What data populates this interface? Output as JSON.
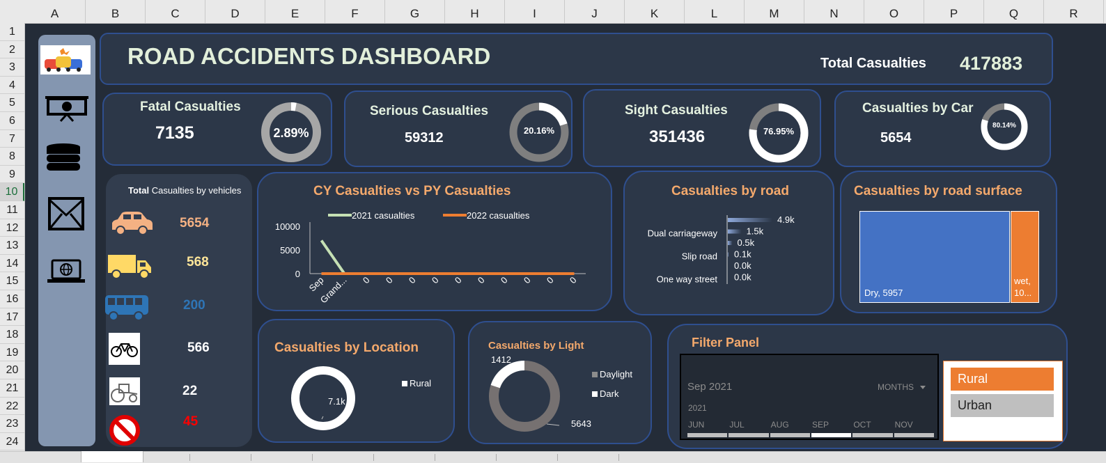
{
  "spreadsheet": {
    "columns": [
      "A",
      "B",
      "C",
      "D",
      "E",
      "F",
      "G",
      "H",
      "I",
      "J",
      "K",
      "L",
      "M",
      "N",
      "O",
      "P",
      "Q",
      "R"
    ],
    "rows": [
      "1",
      "2",
      "3",
      "4",
      "5",
      "6",
      "7",
      "8",
      "9",
      "10",
      "11",
      "12",
      "13",
      "14",
      "15",
      "16",
      "17",
      "18",
      "19",
      "20",
      "21",
      "22",
      "23",
      "24"
    ],
    "selected_row": "10"
  },
  "sidebar": {
    "icons": [
      "car-crash-icon",
      "presentation-chart-icon",
      "database-icon",
      "mail-icon",
      "laptop-globe-icon"
    ]
  },
  "header": {
    "title": "ROAD ACCIDENTS DASHBOARD",
    "total_label": "Total Casualties",
    "total_value": "417883"
  },
  "kpis": [
    {
      "label": "Fatal Casualties",
      "value": "7135",
      "pct_label": "2.89%",
      "fraction": 0.0289
    },
    {
      "label": "Serious Casualties",
      "value": "59312",
      "pct_label": "20.16%",
      "fraction": 0.2016
    },
    {
      "label": "Sight Casualties",
      "value": "351436",
      "pct_label": "76.95%",
      "fraction": 0.7695
    },
    {
      "label": "Casualties by Car",
      "value": "5654",
      "pct_label": "80.14%",
      "fraction": 0.8014
    }
  ],
  "vehicles": {
    "title_bold": "Total",
    "title_rest": " Casualties by vehicles",
    "items": [
      {
        "icon": "car-icon",
        "value": "5654",
        "color": "#f4b183"
      },
      {
        "icon": "truck-icon",
        "value": "568",
        "color": "#ffe699"
      },
      {
        "icon": "bus-icon",
        "value": "200",
        "color": "#2e75b6"
      },
      {
        "icon": "bicycle-icon",
        "value": "566",
        "color": "#ffffff"
      },
      {
        "icon": "tractor-icon",
        "value": "22",
        "color": "#ffffff"
      },
      {
        "icon": "no-entry-icon",
        "value": "45",
        "color": "#ff0000"
      }
    ]
  },
  "colors": {
    "panel": "#2c3748",
    "border": "#2f4f8f",
    "accent": "#f4a96c",
    "series_2021": "#c5e0b4",
    "series_2022": "#ed7d31",
    "dry": "#4472c4",
    "wet": "#ed7d31"
  },
  "chart_data": [
    {
      "type": "line",
      "title": "CY Casualties vs PY Casualties",
      "categories": [
        "Sep",
        "Grand...",
        "0",
        "0",
        "0",
        "0",
        "0",
        "0",
        "0",
        "0",
        "0",
        "0"
      ],
      "series": [
        {
          "name": "2021 casualties",
          "values": [
            7000,
            0,
            null,
            null,
            null,
            null,
            null,
            null,
            null,
            null,
            null,
            null
          ]
        },
        {
          "name": "2022 casualties",
          "values": [
            0,
            0,
            0,
            0,
            0,
            0,
            0,
            0,
            0,
            0,
            0,
            0
          ]
        }
      ],
      "yticks": [
        "10000",
        "5000",
        "0"
      ],
      "ylim": [
        0,
        10000
      ],
      "legend": "top"
    },
    {
      "type": "bar",
      "title": "Casualties by road",
      "categories": [
        "",
        "Dual carriageway",
        "",
        "Slip road",
        "",
        "One way street"
      ],
      "values": [
        4.9,
        1.5,
        0.5,
        0.1,
        0.0,
        0.0
      ],
      "value_labels": [
        "4.9k",
        "1.5k",
        "0.5k",
        "0.1k",
        "0.0k",
        "0.0k"
      ],
      "xlim": [
        0,
        4.9
      ]
    },
    {
      "type": "treemap",
      "title": "Casualties by road surface",
      "items": [
        {
          "label": "Dry, 5957",
          "value": 5957
        },
        {
          "label": "wet, 10...",
          "value": 1000
        }
      ]
    },
    {
      "type": "pie",
      "title": "Casualties by Location",
      "slices": [
        {
          "name": "Rural",
          "value": 7100
        }
      ],
      "data_labels": [
        "7.1k"
      ],
      "legend": "right"
    },
    {
      "type": "pie",
      "title": "Casualties by Light",
      "slices": [
        {
          "name": "Daylight",
          "value": 5643
        },
        {
          "name": "Dark",
          "value": 1412
        }
      ],
      "data_labels": [
        "5643",
        "1412"
      ],
      "legend": "right"
    }
  ],
  "filter_panel": {
    "title": "Filter Panel",
    "timeline": {
      "selection": "Sep 2021",
      "period_label": "MONTHS",
      "year": "2021",
      "months": [
        "JUN",
        "JUL",
        "AUG",
        "SEP",
        "OCT",
        "NOV"
      ],
      "selected_month": "SEP"
    },
    "slicer": [
      "Rural",
      "Urban"
    ],
    "slicer_selected": "Rural"
  }
}
